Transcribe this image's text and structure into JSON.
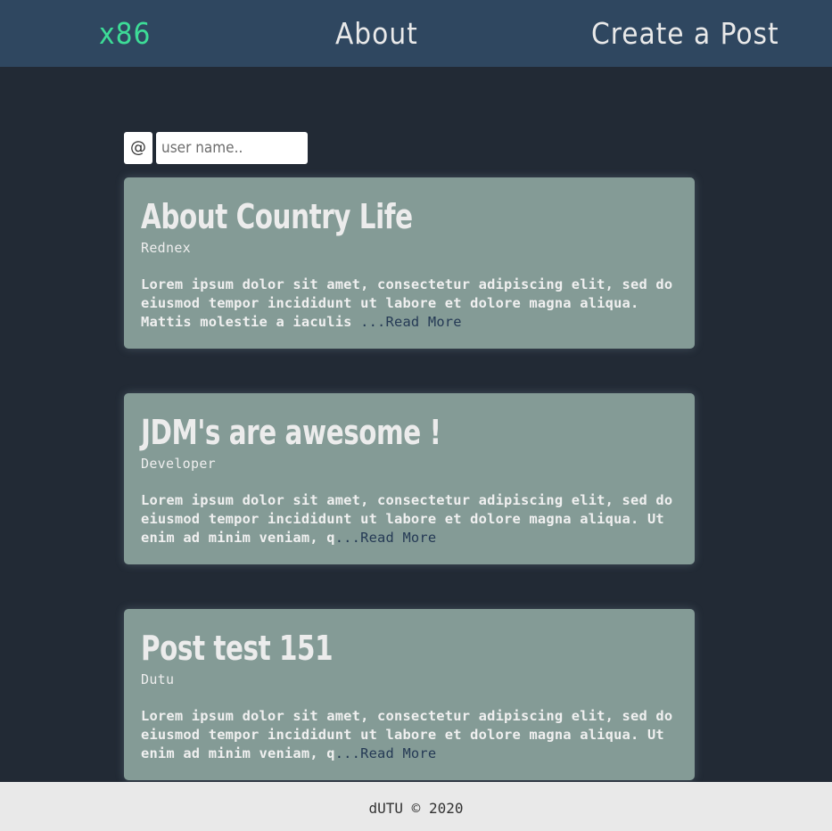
{
  "nav": {
    "brand": "x86",
    "about": "About",
    "create": "Create a Post"
  },
  "search": {
    "prefix": "@",
    "placeholder": "user name.."
  },
  "posts": [
    {
      "title": "About Country Life",
      "author": "Rednex",
      "excerpt": "Lorem ipsum dolor sit amet, consectetur adipiscing elit, sed do eiusmod tempor incididunt ut labore et dolore magna aliqua. Mattis molestie a iaculis ",
      "read_more": "...Read More"
    },
    {
      "title": "JDM's are awesome !",
      "author": "Developer",
      "excerpt": "Lorem ipsum dolor sit amet, consectetur adipiscing elit, sed do eiusmod tempor incididunt ut labore et dolore magna aliqua. Ut enim ad minim veniam, q",
      "read_more": "...Read More"
    },
    {
      "title": "Post test 151",
      "author": "Dutu",
      "excerpt": "Lorem ipsum dolor sit amet, consectetur adipiscing elit, sed do eiusmod tempor incididunt ut labore et dolore magna aliqua. Ut enim ad minim veniam, q",
      "read_more": "...Read More"
    }
  ],
  "footer": {
    "text": "dUTU © 2020"
  },
  "colors": {
    "navbar": "#2f4760",
    "background": "#222a35",
    "brand": "#3ddc97",
    "card": "#849b96",
    "read_more": "#253a55",
    "footer": "#e9e9e9"
  }
}
